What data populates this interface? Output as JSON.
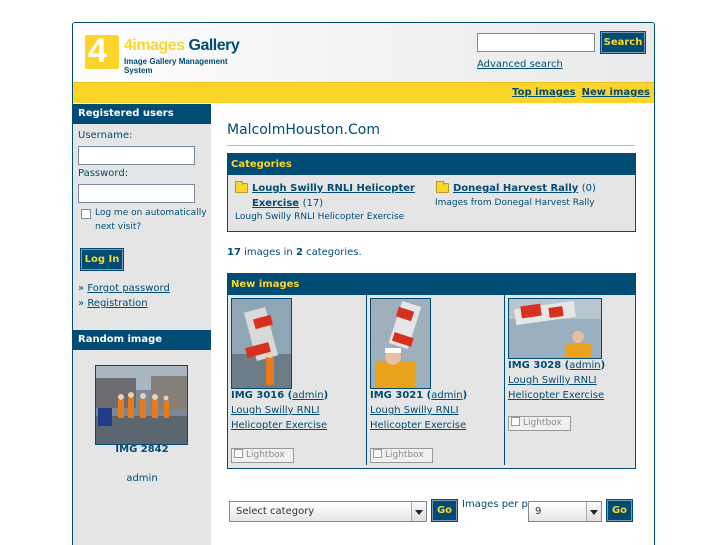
{
  "header": {
    "logo_four": "4",
    "logo_title_a": "4images",
    "logo_title_b": "Gallery",
    "logo_subtitle": "Image Gallery Management System",
    "search_button": "Search",
    "advanced_search": "Advanced search"
  },
  "topnav": {
    "top_images": "Top images",
    "new_images": "New images"
  },
  "sidebar": {
    "registered_heading": "Registered users",
    "username_label": "Username:",
    "password_label": "Password:",
    "autologin_label": "Log me on automatically next visit?",
    "login_button": "Log In",
    "forgot_password": "Forgot password",
    "registration": "Registration",
    "bullet": "»",
    "random_heading": "Random image",
    "random_title": "IMG 2842",
    "random_user": "admin"
  },
  "main": {
    "site_title": "MalcolmHouston.Com",
    "categories_heading": "Categories",
    "categories": [
      {
        "name": "Lough Swilly RNLI Helicopter Exercise",
        "count": "(17)",
        "desc": "Lough Swilly RNLI Helicopter Exercise"
      },
      {
        "name": "Donegal Harvest Rally",
        "count": "(0)",
        "desc": "Images from Donegal Harvest Rally"
      }
    ],
    "count_images": "17",
    "count_text_a": " images in ",
    "count_categories": "2",
    "count_text_b": " categories.",
    "new_images_heading": "New images",
    "new_images": [
      {
        "title": "IMG 3016",
        "user": "admin",
        "category": "Lough Swilly RNLI Helicopter Exercise",
        "lightbox": "Lightbox"
      },
      {
        "title": "IMG 3021",
        "user": "admin",
        "category": "Lough Swilly RNLI Helicopter Exercise",
        "lightbox": "Lightbox"
      },
      {
        "title": "IMG 3028",
        "user": "admin",
        "category": "Lough Swilly RNLI Helicopter Exercise",
        "lightbox": "Lightbox"
      }
    ],
    "select_category": "Select category",
    "go_label": "Go",
    "images_per_page_label": "Images per page:",
    "images_per_page_value": "9"
  },
  "colors": {
    "primary": "#004c75",
    "accent": "#fcd52b",
    "panel": "#e5e5e5"
  }
}
